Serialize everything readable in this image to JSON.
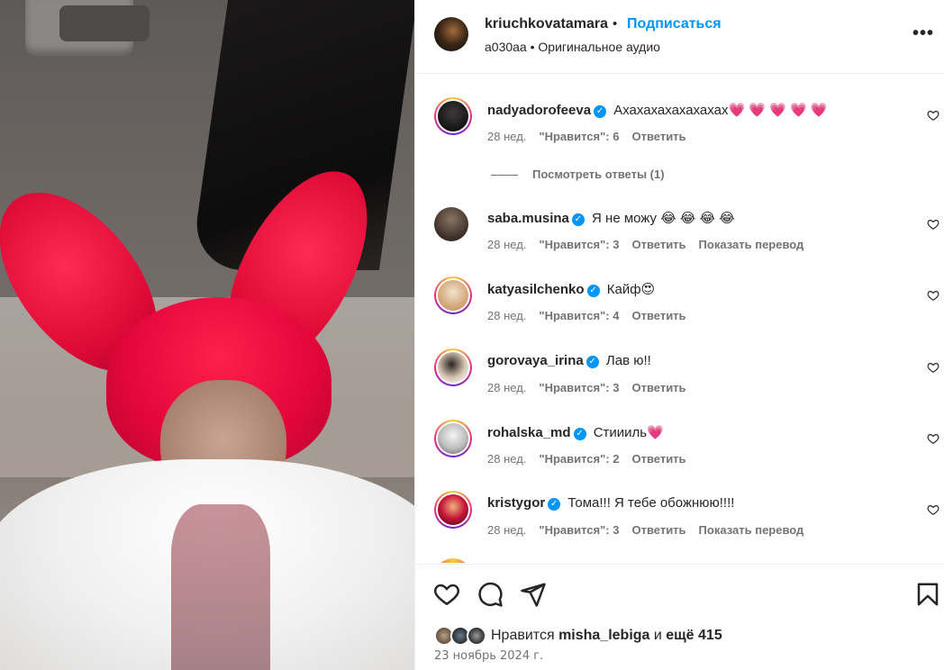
{
  "header": {
    "username": "kriuchkovatamara",
    "separator": "•",
    "follow_label": "Подписаться",
    "audio": "a030aa • Оригинальное аудио",
    "more_label": "•••"
  },
  "comments": [
    {
      "username": "nadyadorofeeva",
      "text": "Ахахахахахахахах",
      "emoji": "💗 💗 💗 💗 💗",
      "time": "28 нед.",
      "likes": "\"Нравится\": 6",
      "reply": "Ответить",
      "translate": ""
    },
    {
      "username": "saba.musina",
      "text": "Я не можу",
      "emoji": "😂 😂 😂 😂",
      "time": "28 нед.",
      "likes": "\"Нравится\": 3",
      "reply": "Ответить",
      "translate": "Показать перевод"
    },
    {
      "username": "katyasilchenko",
      "text": "Кайф",
      "emoji": "😍",
      "time": "28 нед.",
      "likes": "\"Нравится\": 4",
      "reply": "Ответить",
      "translate": ""
    },
    {
      "username": "gorovaya_irina",
      "text": "Лав ю!!",
      "emoji": "",
      "time": "28 нед.",
      "likes": "\"Нравится\": 3",
      "reply": "Ответить",
      "translate": ""
    },
    {
      "username": "rohalska_md",
      "text": "Стиииль",
      "emoji": "💗",
      "time": "28 нед.",
      "likes": "\"Нравится\": 2",
      "reply": "Ответить",
      "translate": ""
    },
    {
      "username": "kristygor",
      "text": "Тома!!! Я тебе обожнюю!!!!",
      "emoji": "",
      "time": "28 нед.",
      "likes": "\"Нравится\": 3",
      "reply": "Ответить",
      "translate": "Показать перевод"
    }
  ],
  "view_replies": "Посмотреть ответы (1)",
  "footer": {
    "likes_prefix": "Нравится",
    "likes_user": "misha_lebiga",
    "likes_mid": "и",
    "likes_count": "ещё 415",
    "date": "23 ноябрь 2024 г."
  },
  "icons": {
    "like": "heart-icon",
    "comment": "comment-icon",
    "share": "share-icon",
    "save": "bookmark-icon"
  },
  "colors": {
    "accent": "#0095f6",
    "verified": "#0095f6",
    "muted": "#737373"
  }
}
